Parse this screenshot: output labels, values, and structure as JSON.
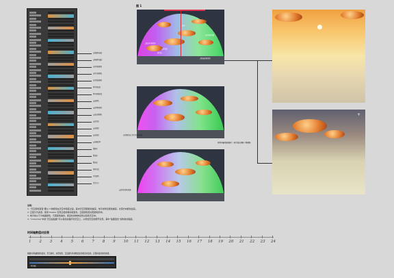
{
  "figure_label": "图 1",
  "inspector": {
    "rows": 60
  },
  "callouts_left": [
    "太阳颜色渐变",
    "太阳颜色强度",
    "天空顶部颜色",
    "天空中部颜色",
    "天空底部颜色",
    "地平线高度",
    "地平线柔和度",
    "云层颜色",
    "云层阴影颜色",
    "云层边缘颜色",
    "云层亮度",
    "云层密度",
    "云层速度",
    "云层覆盖率",
    "雾颜色",
    "雾浓度",
    "雾高度",
    "星星亮度",
    "月亮颜色",
    "月亮大小"
  ],
  "dome_annotations": {
    "top": [
      "太阳方位角控制",
      "天顶",
      "地平线",
      "天空渐变范围",
      "云层高度",
      "太阳高度角控制"
    ],
    "middle": [
      "天空颜色由上到下的渐变过渡"
    ],
    "bottom": [
      "云层的边缘光效果"
    ]
  },
  "right_caption": "游戏中最终效果展示（天空盒正视图 / 侧视图）",
  "notes_title": "说明：",
  "notes": [
    "1.  “天空颜色渐变”要以 3 种颜色在天空中渐变过渡，其中天空顶部颜色偏深，地平线附近颜色偏亮，太阳方向颜色最亮。",
    "2.  云层分为多层，使用 Shader 实现云层的移动和变化，云层颜色受太阳颜色影响。",
    "3.  地平线以下为地面颜色，与雾颜色融合，使远处的物体自然过渡到天空中。",
    "4.  “Cubemap”中的“天空盒贴图”可以叠加在程序化天空上，以增加天空的细节表现，其中“贴图混合”控制叠加强度。"
  ],
  "timeline": {
    "title": "时间轴数值对应表",
    "ticks": [
      "1",
      "2",
      "3",
      "4",
      "5",
      "6",
      "7",
      "8",
      "9",
      "10",
      "11",
      "12",
      "13",
      "14",
      "15",
      "16",
      "17",
      "18",
      "19",
      "20",
      "21",
      "22",
      "23",
      "24"
    ],
    "description": "根据时间轴数值的变化，天空颜色、太阳位置、云层颜色等参数会发生相应的变化，实现昼夜交替的效果。",
    "bar_caption": "时间轴"
  },
  "colors": {
    "dome_magenta": "#e040e0",
    "dome_green": "#50e060",
    "sky_blue": "#3a78c8",
    "sunset_gold": "#f0b060"
  }
}
